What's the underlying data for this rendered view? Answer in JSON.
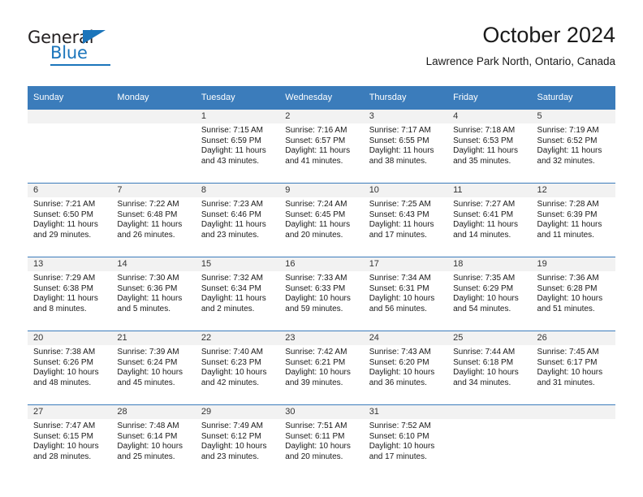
{
  "logo": {
    "word_one": "General",
    "word_two": "Blue",
    "triangle_icon": "blue-triangle-icon"
  },
  "header": {
    "title": "October 2024",
    "subtitle": "Lawrence Park North, Ontario, Canada"
  },
  "colors": {
    "header_blue": "#3b7cbb",
    "logo_blue": "#1b75bb",
    "daynum_band": "#f2f2f2",
    "text": "#1a1a1a"
  },
  "weekday_headers": [
    "Sunday",
    "Monday",
    "Tuesday",
    "Wednesday",
    "Thursday",
    "Friday",
    "Saturday"
  ],
  "weeks": [
    [
      {
        "empty": true,
        "day": ""
      },
      {
        "empty": true,
        "day": ""
      },
      {
        "day": "1",
        "sunrise": "Sunrise: 7:15 AM",
        "sunset": "Sunset: 6:59 PM",
        "daylight_1": "Daylight: 11 hours",
        "daylight_2": "and 43 minutes."
      },
      {
        "day": "2",
        "sunrise": "Sunrise: 7:16 AM",
        "sunset": "Sunset: 6:57 PM",
        "daylight_1": "Daylight: 11 hours",
        "daylight_2": "and 41 minutes."
      },
      {
        "day": "3",
        "sunrise": "Sunrise: 7:17 AM",
        "sunset": "Sunset: 6:55 PM",
        "daylight_1": "Daylight: 11 hours",
        "daylight_2": "and 38 minutes."
      },
      {
        "day": "4",
        "sunrise": "Sunrise: 7:18 AM",
        "sunset": "Sunset: 6:53 PM",
        "daylight_1": "Daylight: 11 hours",
        "daylight_2": "and 35 minutes."
      },
      {
        "day": "5",
        "sunrise": "Sunrise: 7:19 AM",
        "sunset": "Sunset: 6:52 PM",
        "daylight_1": "Daylight: 11 hours",
        "daylight_2": "and 32 minutes."
      }
    ],
    [
      {
        "day": "6",
        "sunrise": "Sunrise: 7:21 AM",
        "sunset": "Sunset: 6:50 PM",
        "daylight_1": "Daylight: 11 hours",
        "daylight_2": "and 29 minutes."
      },
      {
        "day": "7",
        "sunrise": "Sunrise: 7:22 AM",
        "sunset": "Sunset: 6:48 PM",
        "daylight_1": "Daylight: 11 hours",
        "daylight_2": "and 26 minutes."
      },
      {
        "day": "8",
        "sunrise": "Sunrise: 7:23 AM",
        "sunset": "Sunset: 6:46 PM",
        "daylight_1": "Daylight: 11 hours",
        "daylight_2": "and 23 minutes."
      },
      {
        "day": "9",
        "sunrise": "Sunrise: 7:24 AM",
        "sunset": "Sunset: 6:45 PM",
        "daylight_1": "Daylight: 11 hours",
        "daylight_2": "and 20 minutes."
      },
      {
        "day": "10",
        "sunrise": "Sunrise: 7:25 AM",
        "sunset": "Sunset: 6:43 PM",
        "daylight_1": "Daylight: 11 hours",
        "daylight_2": "and 17 minutes."
      },
      {
        "day": "11",
        "sunrise": "Sunrise: 7:27 AM",
        "sunset": "Sunset: 6:41 PM",
        "daylight_1": "Daylight: 11 hours",
        "daylight_2": "and 14 minutes."
      },
      {
        "day": "12",
        "sunrise": "Sunrise: 7:28 AM",
        "sunset": "Sunset: 6:39 PM",
        "daylight_1": "Daylight: 11 hours",
        "daylight_2": "and 11 minutes."
      }
    ],
    [
      {
        "day": "13",
        "sunrise": "Sunrise: 7:29 AM",
        "sunset": "Sunset: 6:38 PM",
        "daylight_1": "Daylight: 11 hours",
        "daylight_2": "and 8 minutes."
      },
      {
        "day": "14",
        "sunrise": "Sunrise: 7:30 AM",
        "sunset": "Sunset: 6:36 PM",
        "daylight_1": "Daylight: 11 hours",
        "daylight_2": "and 5 minutes."
      },
      {
        "day": "15",
        "sunrise": "Sunrise: 7:32 AM",
        "sunset": "Sunset: 6:34 PM",
        "daylight_1": "Daylight: 11 hours",
        "daylight_2": "and 2 minutes."
      },
      {
        "day": "16",
        "sunrise": "Sunrise: 7:33 AM",
        "sunset": "Sunset: 6:33 PM",
        "daylight_1": "Daylight: 10 hours",
        "daylight_2": "and 59 minutes."
      },
      {
        "day": "17",
        "sunrise": "Sunrise: 7:34 AM",
        "sunset": "Sunset: 6:31 PM",
        "daylight_1": "Daylight: 10 hours",
        "daylight_2": "and 56 minutes."
      },
      {
        "day": "18",
        "sunrise": "Sunrise: 7:35 AM",
        "sunset": "Sunset: 6:29 PM",
        "daylight_1": "Daylight: 10 hours",
        "daylight_2": "and 54 minutes."
      },
      {
        "day": "19",
        "sunrise": "Sunrise: 7:36 AM",
        "sunset": "Sunset: 6:28 PM",
        "daylight_1": "Daylight: 10 hours",
        "daylight_2": "and 51 minutes."
      }
    ],
    [
      {
        "day": "20",
        "sunrise": "Sunrise: 7:38 AM",
        "sunset": "Sunset: 6:26 PM",
        "daylight_1": "Daylight: 10 hours",
        "daylight_2": "and 48 minutes."
      },
      {
        "day": "21",
        "sunrise": "Sunrise: 7:39 AM",
        "sunset": "Sunset: 6:24 PM",
        "daylight_1": "Daylight: 10 hours",
        "daylight_2": "and 45 minutes."
      },
      {
        "day": "22",
        "sunrise": "Sunrise: 7:40 AM",
        "sunset": "Sunset: 6:23 PM",
        "daylight_1": "Daylight: 10 hours",
        "daylight_2": "and 42 minutes."
      },
      {
        "day": "23",
        "sunrise": "Sunrise: 7:42 AM",
        "sunset": "Sunset: 6:21 PM",
        "daylight_1": "Daylight: 10 hours",
        "daylight_2": "and 39 minutes."
      },
      {
        "day": "24",
        "sunrise": "Sunrise: 7:43 AM",
        "sunset": "Sunset: 6:20 PM",
        "daylight_1": "Daylight: 10 hours",
        "daylight_2": "and 36 minutes."
      },
      {
        "day": "25",
        "sunrise": "Sunrise: 7:44 AM",
        "sunset": "Sunset: 6:18 PM",
        "daylight_1": "Daylight: 10 hours",
        "daylight_2": "and 34 minutes."
      },
      {
        "day": "26",
        "sunrise": "Sunrise: 7:45 AM",
        "sunset": "Sunset: 6:17 PM",
        "daylight_1": "Daylight: 10 hours",
        "daylight_2": "and 31 minutes."
      }
    ],
    [
      {
        "day": "27",
        "sunrise": "Sunrise: 7:47 AM",
        "sunset": "Sunset: 6:15 PM",
        "daylight_1": "Daylight: 10 hours",
        "daylight_2": "and 28 minutes."
      },
      {
        "day": "28",
        "sunrise": "Sunrise: 7:48 AM",
        "sunset": "Sunset: 6:14 PM",
        "daylight_1": "Daylight: 10 hours",
        "daylight_2": "and 25 minutes."
      },
      {
        "day": "29",
        "sunrise": "Sunrise: 7:49 AM",
        "sunset": "Sunset: 6:12 PM",
        "daylight_1": "Daylight: 10 hours",
        "daylight_2": "and 23 minutes."
      },
      {
        "day": "30",
        "sunrise": "Sunrise: 7:51 AM",
        "sunset": "Sunset: 6:11 PM",
        "daylight_1": "Daylight: 10 hours",
        "daylight_2": "and 20 minutes."
      },
      {
        "day": "31",
        "sunrise": "Sunrise: 7:52 AM",
        "sunset": "Sunset: 6:10 PM",
        "daylight_1": "Daylight: 10 hours",
        "daylight_2": "and 17 minutes."
      },
      {
        "empty": true,
        "day": ""
      },
      {
        "empty": true,
        "day": ""
      }
    ]
  ]
}
